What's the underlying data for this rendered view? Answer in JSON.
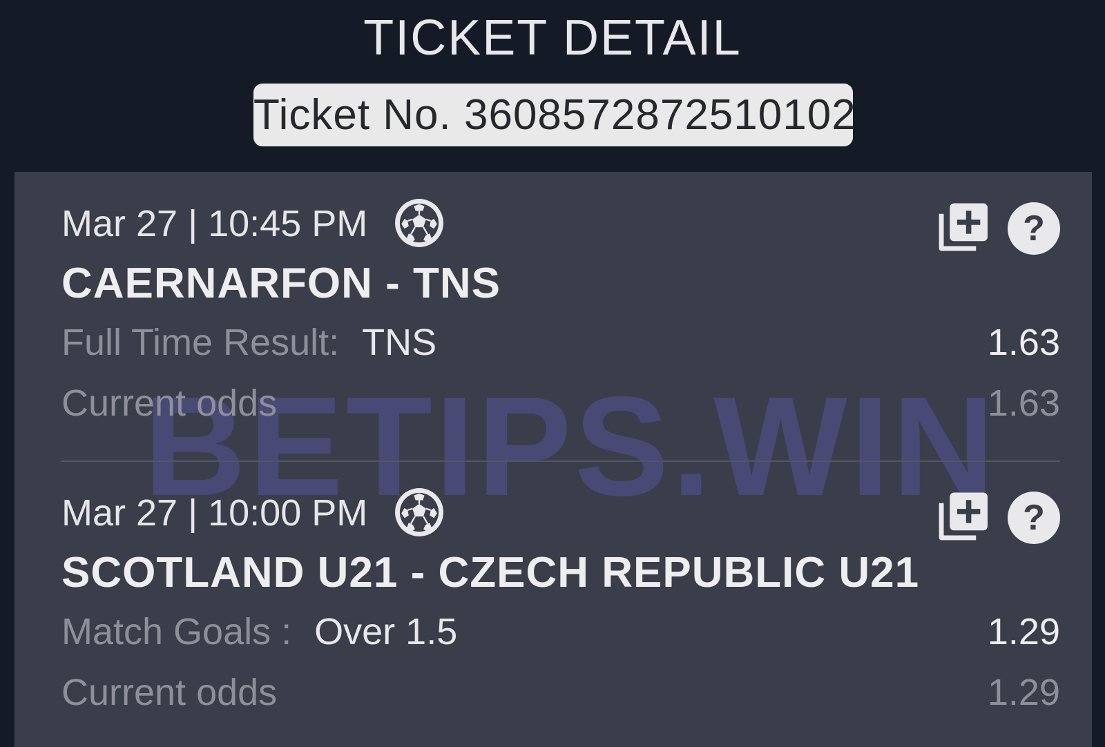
{
  "header": {
    "title": "TICKET DETAIL",
    "ticket_number": "Ticket No. 3608572872510102"
  },
  "watermark": "BETIPS.WIN",
  "bets": [
    {
      "datetime": "Mar 27 | 10:45 PM",
      "sport_icon": "soccer-ball-icon",
      "match": "CAERNARFON - TNS",
      "market_label": "Full Time Result:",
      "selection": "TNS",
      "odds": "1.63",
      "current_odds_label": "Current odds",
      "current_odds": "1.63"
    },
    {
      "datetime": "Mar 27 | 10:00 PM",
      "sport_icon": "soccer-ball-icon",
      "match": "SCOTLAND U21 - CZECH REPUBLIC U21",
      "market_label": "Match Goals :",
      "selection": "Over 1.5",
      "odds": "1.29",
      "current_odds_label": "Current odds",
      "current_odds": "1.29"
    }
  ],
  "icons": {
    "add": "add-to-betslip-icon",
    "help": "?"
  },
  "colors": {
    "background": "#151b26",
    "panel": "#3a3e4a",
    "watermark": "#4b4a7a",
    "muted_text": "#8e9099"
  }
}
